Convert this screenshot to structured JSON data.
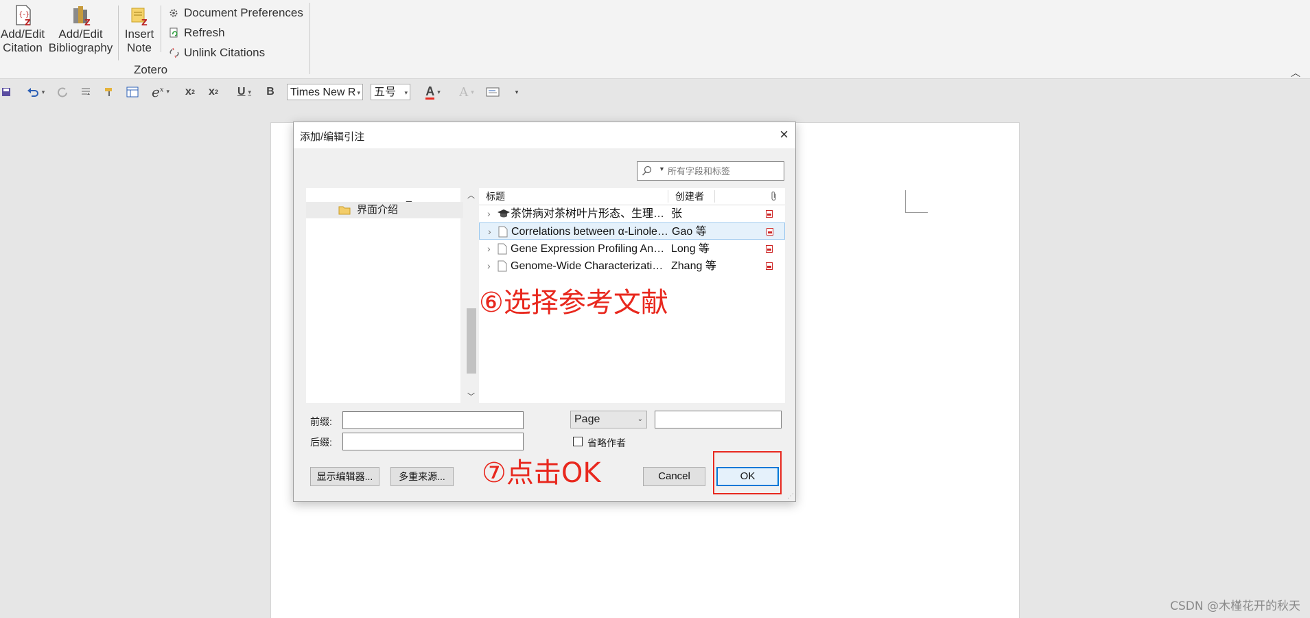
{
  "ribbon": {
    "add_edit_citation": [
      "Add/Edit",
      "Citation"
    ],
    "add_edit_bibliography": [
      "Add/Edit",
      "Bibliography"
    ],
    "insert_note": [
      "Insert",
      "Note"
    ],
    "document_preferences": "Document Preferences",
    "refresh": "Refresh",
    "unlink_citations": "Unlink Citations",
    "group_label": "Zotero"
  },
  "toolbar": {
    "font_name": "Times New R",
    "font_size": "五号",
    "bold": "B",
    "underline": "U",
    "superscript": "x",
    "superscript_mark": "2",
    "subscript": "x",
    "subscript_mark": "2",
    "font_color_letter": "A",
    "highlight_letter": "A",
    "font_color": "#e8281e"
  },
  "dialog": {
    "title": "添加/编辑引注",
    "close_icon": "×",
    "search_placeholder": "所有字段和标签",
    "collections": {
      "dash": "_",
      "items": [
        "界面介绍"
      ]
    },
    "columns": {
      "title": "标题",
      "creator": "创建者"
    },
    "rows": [
      {
        "title": "茶饼病对茶树叶片形态、生理指标和品...",
        "creator": "张",
        "type": "thesis-icon",
        "selected": false
      },
      {
        "title": "Correlations between α-Linolenic Ac...",
        "creator": "Gao 等",
        "type": "document-icon",
        "selected": true
      },
      {
        "title": "Gene Expression Profiling Analysis o...",
        "creator": "Long 等",
        "type": "document-icon",
        "selected": false
      },
      {
        "title": "Genome-Wide Characterization and...",
        "creator": "Zhang 等",
        "type": "document-icon",
        "selected": false
      }
    ],
    "prefix_label": "前缀:",
    "suffix_label": "后缀:",
    "prefix_value": "",
    "suffix_value": "",
    "locator_type": "Page",
    "locator_value": "",
    "suppress_author_label": "省略作者",
    "suppress_author_checked": false,
    "show_editor_button": "显示编辑器...",
    "multiple_sources_button": "多重来源...",
    "cancel_button": "Cancel",
    "ok_button": "OK"
  },
  "annotations": {
    "step6": "⑥选择参考文献",
    "step7": "⑦点击OK",
    "color": "#e8281e"
  },
  "watermark": "CSDN @木槿花开的秋天"
}
